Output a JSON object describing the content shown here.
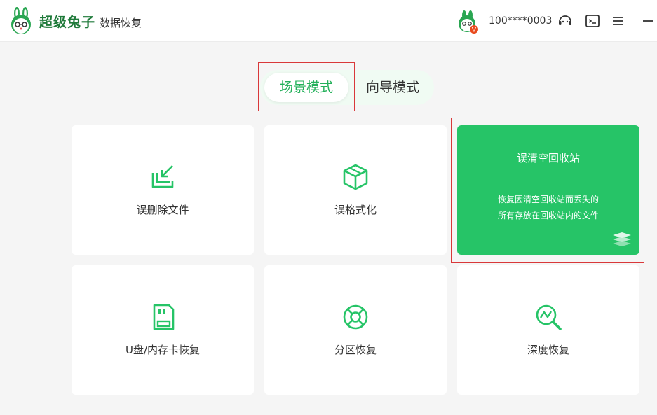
{
  "app": {
    "brand_name": "超级兔子",
    "brand_sub": "数据恢复",
    "user_id": "100****0003",
    "vip_badge": "V"
  },
  "header_icons": [
    "support-icon",
    "feedback-icon",
    "menu-icon",
    "minimize-icon"
  ],
  "mode_tabs": [
    {
      "label": "场景模式",
      "active": true
    },
    {
      "label": "向导模式",
      "active": false
    }
  ],
  "cards": [
    {
      "label": "误删除文件",
      "icon": "file-restore-icon"
    },
    {
      "label": "误格式化",
      "icon": "cube-icon"
    },
    {
      "label": "误清空回收站",
      "icon": "recycle-bin-icon",
      "featured": true,
      "desc_line1": "恢复因清空回收站而丢失的",
      "desc_line2": "所有存放在回收站内的文件"
    },
    {
      "label": "U盘/内存卡恢复",
      "icon": "sd-card-icon"
    },
    {
      "label": "分区恢复",
      "icon": "partition-icon"
    },
    {
      "label": "深度恢复",
      "icon": "deep-scan-icon"
    }
  ],
  "colors": {
    "accent": "#26c467",
    "accent_text": "#23b05a",
    "highlight": "#d9383a"
  }
}
